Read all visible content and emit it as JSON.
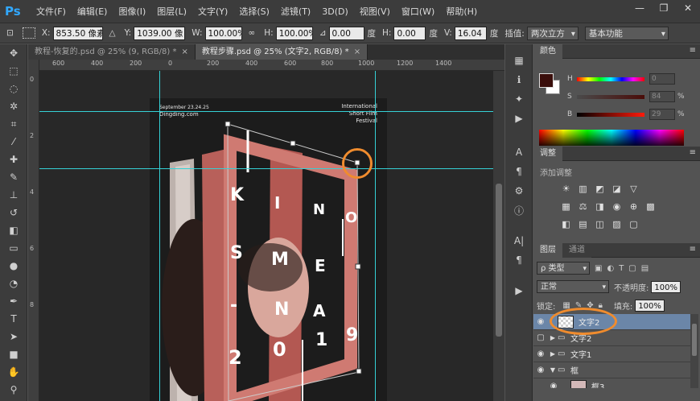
{
  "app": {
    "logo": "Ps"
  },
  "menu": [
    "文件(F)",
    "编辑(E)",
    "图像(I)",
    "图层(L)",
    "文字(Y)",
    "选择(S)",
    "滤镜(T)",
    "3D(D)",
    "视图(V)",
    "窗口(W)",
    "帮助(H)"
  ],
  "window_controls": [
    "—",
    "❐",
    "✕"
  ],
  "options": {
    "x_label": "X:",
    "x_value": "853.50 像素",
    "y_label": "Y:",
    "y_value": "1039.00 像",
    "w_label": "W:",
    "w_value": "100.00%",
    "h_label": "H:",
    "h_value": "100.00%",
    "angle_value": "0.00",
    "angle_unit": "度",
    "hskew_label": "H:",
    "hskew_value": "0.00",
    "hskew_unit": "度",
    "vskew_label": "V:",
    "vskew_value": "16.04",
    "vskew_unit": "度",
    "interp_label": "插值:",
    "interp_value": "两次立方",
    "workspace": "基本功能"
  },
  "tabs": [
    {
      "label": "教程-恢复的.psd @ 25% (9, RGB/8) *",
      "active": false
    },
    {
      "label": "教程步骤.psd @ 25% (文字2, RGB/8) *",
      "active": true
    }
  ],
  "ruler_h": [
    "600",
    "400",
    "200",
    "0",
    "200",
    "400",
    "600",
    "800",
    "1000",
    "1200",
    "1400"
  ],
  "ruler_v": [
    "0",
    "2",
    "4",
    "6",
    "8"
  ],
  "poster": {
    "date": "September 23.24.25",
    "site": "Dingding.com",
    "festival_line1": "International",
    "festival_line2": "Short Film",
    "festival_line3": "Festival",
    "letters": [
      "K",
      "I",
      "N",
      "O",
      "S",
      "M",
      "E",
      "-",
      "N",
      "A",
      "2",
      "0",
      "1",
      "9"
    ]
  },
  "color_panel": {
    "tab": "颜色",
    "h_label": "H",
    "h_value": "0",
    "s_label": "S",
    "s_value": "84",
    "s_unit": "%",
    "b_label": "B",
    "b_value": "29",
    "b_unit": "%",
    "foreground": "#3a0e0b"
  },
  "adjust_panel": {
    "tab": "调整",
    "subtitle": "添加调整"
  },
  "layers_panel": {
    "tab_layers": "图层",
    "tab_channels": "通道",
    "filter_kind": "ρ 类型",
    "blend_mode": "正常",
    "opacity_label": "不透明度:",
    "opacity_value": "100%",
    "lock_label": "锁定:",
    "fill_label": "填充:",
    "fill_value": "100%",
    "layers": [
      {
        "name": "文字2",
        "type": "text",
        "selected": true,
        "visible": true
      },
      {
        "name": "文字2",
        "type": "group",
        "selected": false,
        "visible": false
      },
      {
        "name": "文字1",
        "type": "group",
        "selected": false,
        "visible": true
      },
      {
        "name": "框",
        "type": "group-open",
        "selected": false,
        "visible": true
      },
      {
        "name": "框3",
        "type": "image",
        "selected": false,
        "visible": true
      }
    ]
  }
}
